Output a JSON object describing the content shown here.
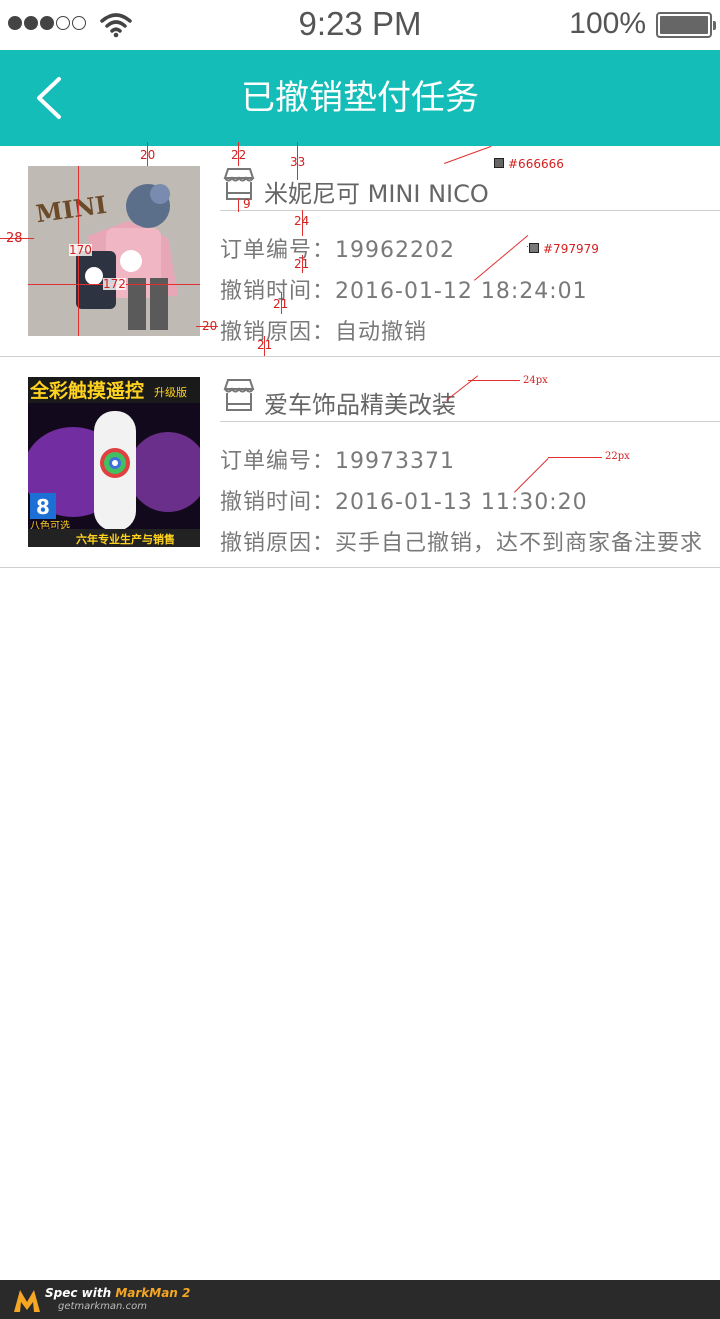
{
  "status_bar": {
    "signal_filled": 3,
    "signal_total": 5,
    "wifi_icon": "wifi-icon",
    "time": "9:23 PM",
    "battery_percent": "100%",
    "battery_level": 1.0
  },
  "nav": {
    "back_icon": "chevron-left-icon",
    "title": "已撤销垫付任务",
    "background_color": "#14bdb8"
  },
  "tasks": [
    {
      "store_icon": "store-icon",
      "store_name": "米妮尼可 MINI NICO",
      "order_label": "订单编号：",
      "order_number": "19962202",
      "time_label": "撤销时间：",
      "cancel_time": "2016-01-12 18:24:01",
      "reason_label": "撤销原因：",
      "reason": "自动撤销"
    },
    {
      "store_icon": "store-icon",
      "store_name": "爱车饰品精美改装",
      "order_label": "订单编号：",
      "order_number": "19973371",
      "time_label": "撤销时间：",
      "cancel_time": "2016-01-13 11:30:20",
      "reason_label": "撤销原因：",
      "reason": "买手自己撤销，达不到商家备注要求"
    }
  ],
  "product_images": {
    "first_text": "MINI",
    "second_banner": "全彩触摸遥控",
    "second_badge": "升级版",
    "second_number": "8",
    "second_color_label": "八色可选",
    "second_footer": "六年专业生产与销售"
  },
  "annotations": {
    "color_store_name": "#666666",
    "color_info_text": "#797979",
    "size_store_name": "24px",
    "size_info_text": "22px",
    "spacing_top": "20",
    "spacing_icon_top": "22",
    "spacing_name_top": "33",
    "spacing_icon_gap": "9",
    "spacing_row1": "24",
    "spacing_row2": "21",
    "spacing_row3": "21",
    "spacing_bottom": "21",
    "image_height": "170",
    "image_width": "172",
    "image_left": "28",
    "image_gap": "20"
  },
  "footer": {
    "spec_prefix": "Spec with ",
    "brand": "MarkMan 2",
    "url": "getmarkman.com"
  }
}
